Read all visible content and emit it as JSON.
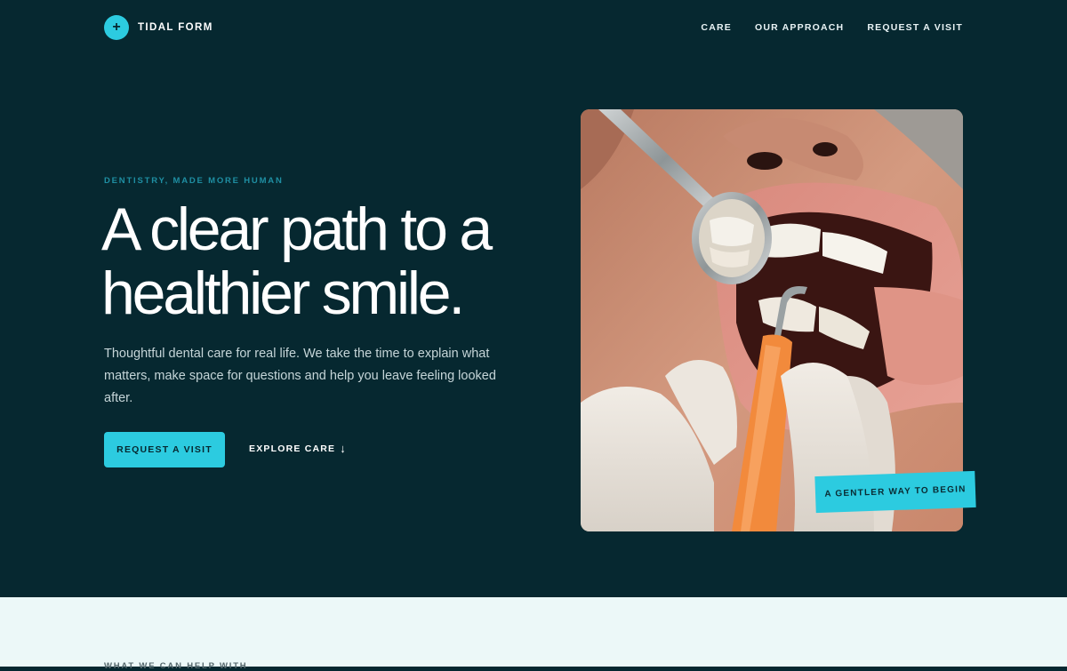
{
  "header": {
    "logo_icon": "plus-icon",
    "logo_glyph": "+",
    "brand": "TIDAL FORM",
    "nav": [
      {
        "label": "CARE"
      },
      {
        "label": "OUR APPROACH"
      },
      {
        "label": "REQUEST A VISIT"
      }
    ]
  },
  "hero": {
    "eyebrow": "DENTISTRY, MADE MORE HUMAN",
    "headline": "A clear path to a healthier smile.",
    "lede": "Thoughtful dental care for real life. We take the time to explain what matters, make space for questions and help you leave feeling looked after.",
    "primary_cta": "REQUEST A VISIT",
    "secondary_cta": "EXPLORE CARE",
    "secondary_icon": "arrow-down-icon",
    "secondary_glyph": "↓",
    "badge": "A GENTLER WAY TO BEGIN"
  },
  "next_section": {
    "eyebrow": "WHAT WE CAN HELP WITH"
  },
  "colors": {
    "background": "#062830",
    "accent": "#2ccbe0",
    "eyebrow": "#1f8fa3",
    "section_background": "#ecf8f8"
  }
}
